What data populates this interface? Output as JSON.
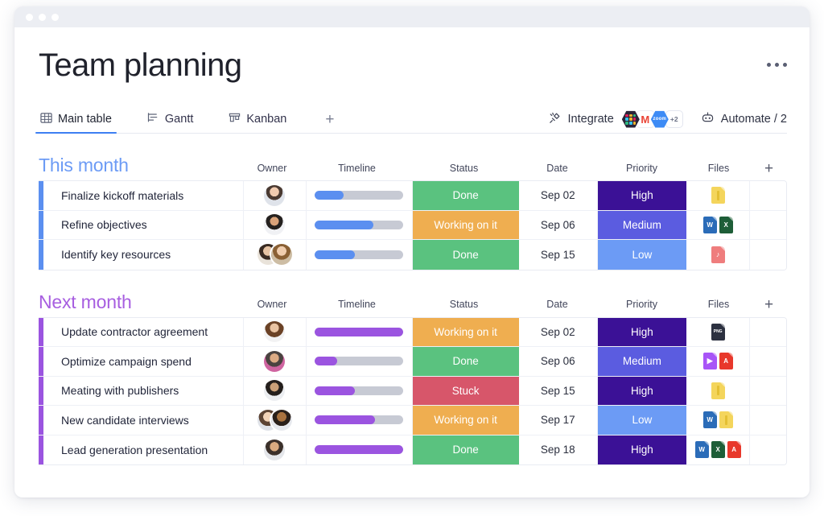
{
  "window": {
    "dots": 3
  },
  "header": {
    "title": "Team planning",
    "kebab_label": "more-options"
  },
  "tabs": [
    {
      "label": "Main table",
      "icon": "grid-icon",
      "active": true
    },
    {
      "label": "Gantt",
      "icon": "gantt-icon",
      "active": false
    },
    {
      "label": "Kanban",
      "icon": "kanban-icon",
      "active": false
    }
  ],
  "tab_add_label": "+",
  "toolbar": {
    "integrate_label": "Integrate",
    "integrate_icon": "plug-icon",
    "integrations": [
      {
        "name": "slack",
        "label": ""
      },
      {
        "name": "gmail",
        "label": "M"
      },
      {
        "name": "zoom",
        "label": "zoom"
      },
      {
        "name": "more",
        "label": "+2"
      }
    ],
    "automate_label": "Automate / 2",
    "automate_icon": "robot-icon"
  },
  "columns": [
    "Owner",
    "Timeline",
    "Status",
    "Date",
    "Priority",
    "Files"
  ],
  "column_add_label": "+",
  "colors": {
    "group_blue": "#6c9bf5",
    "group_purple": "#a75ee0",
    "done": "#5ac27f",
    "working": "#efae50",
    "stuck": "#d7566a",
    "high": "#3b1196",
    "medium": "#5b5ce0",
    "low": "#6c9bf5",
    "tab_underline": "#3d7ff2",
    "bar_track": "#c7cad4"
  },
  "groups": [
    {
      "title": "This month",
      "color": "#6c9bf5",
      "bar_color": "#5b8ff0",
      "rows": [
        {
          "name": "Finalize kickoff materials",
          "owners": [
            {
              "id": "a1"
            }
          ],
          "progress": 33,
          "status": "Done",
          "status_color": "#5ac27f",
          "date": "Sep 02",
          "priority": "High",
          "priority_color": "#3b1196",
          "files": [
            {
              "type": "zip",
              "label": ""
            }
          ]
        },
        {
          "name": "Refine objectives",
          "owners": [
            {
              "id": "a2"
            }
          ],
          "progress": 66,
          "status": "Working on it",
          "status_color": "#efae50",
          "date": "Sep 06",
          "priority": "Medium",
          "priority_color": "#5b5ce0",
          "files": [
            {
              "type": "word",
              "label": "W"
            },
            {
              "type": "excel",
              "label": "X"
            }
          ]
        },
        {
          "name": "Identify key resources",
          "owners": [
            {
              "id": "a3"
            },
            {
              "id": "a4"
            }
          ],
          "progress": 45,
          "status": "Done",
          "status_color": "#5ac27f",
          "date": "Sep 15",
          "priority": "Low",
          "priority_color": "#6c9bf5",
          "files": [
            {
              "type": "music",
              "label": "♪"
            }
          ]
        }
      ]
    },
    {
      "title": "Next month",
      "color": "#a75ee0",
      "bar_color": "#9b54e0",
      "rows": [
        {
          "name": "Update contractor agreement",
          "owners": [
            {
              "id": "b1"
            }
          ],
          "progress": 100,
          "status": "Working on it",
          "status_color": "#efae50",
          "date": "Sep 02",
          "priority": "High",
          "priority_color": "#3b1196",
          "files": [
            {
              "type": "png",
              "label": "PNG"
            }
          ]
        },
        {
          "name": "Optimize campaign spend",
          "owners": [
            {
              "id": "b2"
            }
          ],
          "progress": 25,
          "status": "Done",
          "status_color": "#5ac27f",
          "date": "Sep 06",
          "priority": "Medium",
          "priority_color": "#5b5ce0",
          "files": [
            {
              "type": "video",
              "label": "▶"
            },
            {
              "type": "pdf",
              "label": "A"
            }
          ]
        },
        {
          "name": "Meating with publishers",
          "owners": [
            {
              "id": "b3"
            }
          ],
          "progress": 45,
          "status": "Stuck",
          "status_color": "#d7566a",
          "date": "Sep 15",
          "priority": "High",
          "priority_color": "#3b1196",
          "files": [
            {
              "type": "zip",
              "label": ""
            }
          ]
        },
        {
          "name": "New candidate interviews",
          "owners": [
            {
              "id": "b4"
            },
            {
              "id": "b5"
            }
          ],
          "progress": 68,
          "status": "Working on it",
          "status_color": "#efae50",
          "date": "Sep 17",
          "priority": "Low",
          "priority_color": "#6c9bf5",
          "files": [
            {
              "type": "word",
              "label": "W"
            },
            {
              "type": "zip",
              "label": ""
            }
          ]
        },
        {
          "name": "Lead generation presentation",
          "owners": [
            {
              "id": "b6"
            }
          ],
          "progress": 100,
          "status": "Done",
          "status_color": "#5ac27f",
          "date": "Sep 18",
          "priority": "High",
          "priority_color": "#3b1196",
          "files": [
            {
              "type": "word",
              "label": "W"
            },
            {
              "type": "excel",
              "label": "X"
            },
            {
              "type": "pdf",
              "label": "A"
            }
          ]
        }
      ]
    }
  ]
}
